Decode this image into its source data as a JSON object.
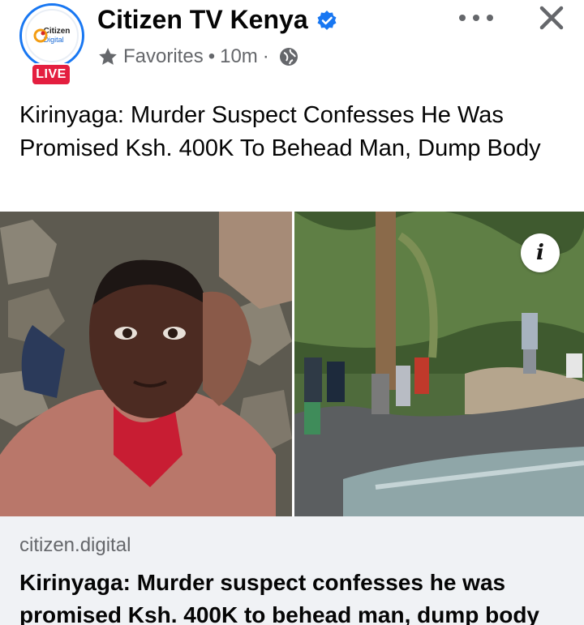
{
  "header": {
    "page_name": "Citizen TV Kenya",
    "live_label": "LIVE",
    "logo": {
      "line1": "Citizen",
      "line2": "Digital"
    },
    "audience": "Favorites",
    "separator": "•",
    "time": "10m",
    "time_separator": "·",
    "icons": {
      "verified": "verified-badge-icon",
      "star": "star-icon",
      "globe": "globe-icon",
      "more": "more-options-icon",
      "close": "close-icon"
    }
  },
  "post": {
    "text": "Kirinyaga: Murder Suspect Confesses He Was Promised Ksh. 400K To Behead Man, Dump Body"
  },
  "media": {
    "info_label": "i"
  },
  "link_preview": {
    "domain": "citizen.digital",
    "title": "Kirinyaga: Murder suspect confesses he was promised Ksh. 400K to behead man, dump body"
  },
  "colors": {
    "accent": "#1877f2",
    "live": "#e41e3f",
    "secondary_text": "#65676b",
    "card_bg": "#f0f2f5"
  }
}
